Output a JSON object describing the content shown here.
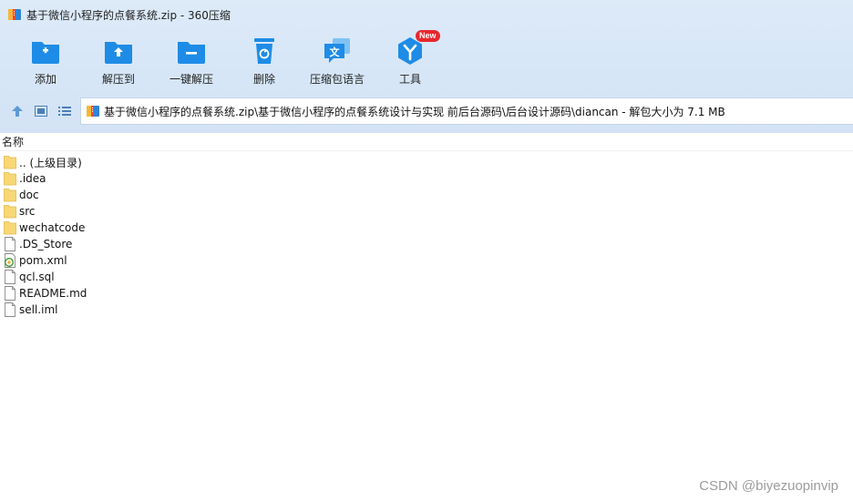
{
  "window": {
    "title": "基于微信小程序的点餐系统.zip - 360压缩",
    "title_icon": "archive-icon"
  },
  "toolbar": {
    "items": [
      {
        "label": "添加",
        "icon": "add-icon"
      },
      {
        "label": "解压到",
        "icon": "extract-to-icon"
      },
      {
        "label": "一键解压",
        "icon": "one-click-extract-icon"
      },
      {
        "label": "删除",
        "icon": "delete-icon"
      },
      {
        "label": "压缩包语言",
        "icon": "language-icon"
      },
      {
        "label": "工具",
        "icon": "tools-icon",
        "badge": "New"
      }
    ]
  },
  "nav": {
    "up_icon": "up-arrow-icon",
    "view_icon": "thumbnail-view-icon",
    "list_icon": "list-view-icon"
  },
  "address": {
    "path": "基于微信小程序的点餐系统.zip\\基于微信小程序的点餐系统设计与实现 前后台源码\\后台设计源码\\diancan - 解包大小为 7.1 MB"
  },
  "file_list": {
    "column_header": "名称",
    "rows": [
      {
        "name": ".. (上级目录)",
        "type": "folder"
      },
      {
        "name": ".idea",
        "type": "folder"
      },
      {
        "name": "doc",
        "type": "folder"
      },
      {
        "name": "src",
        "type": "folder"
      },
      {
        "name": "wechatcode",
        "type": "folder"
      },
      {
        "name": ".DS_Store",
        "type": "file"
      },
      {
        "name": "pom.xml",
        "type": "xml"
      },
      {
        "name": "qcl.sql",
        "type": "file"
      },
      {
        "name": "README.md",
        "type": "file"
      },
      {
        "name": "sell.iml",
        "type": "file"
      }
    ]
  },
  "watermark": "CSDN @biyezuopinvip",
  "colors": {
    "accent_blue": "#1e8ce6",
    "chrome_bg": "#d6e6f7",
    "folder_yellow": "#f8d775",
    "badge_red": "#e8262d"
  }
}
